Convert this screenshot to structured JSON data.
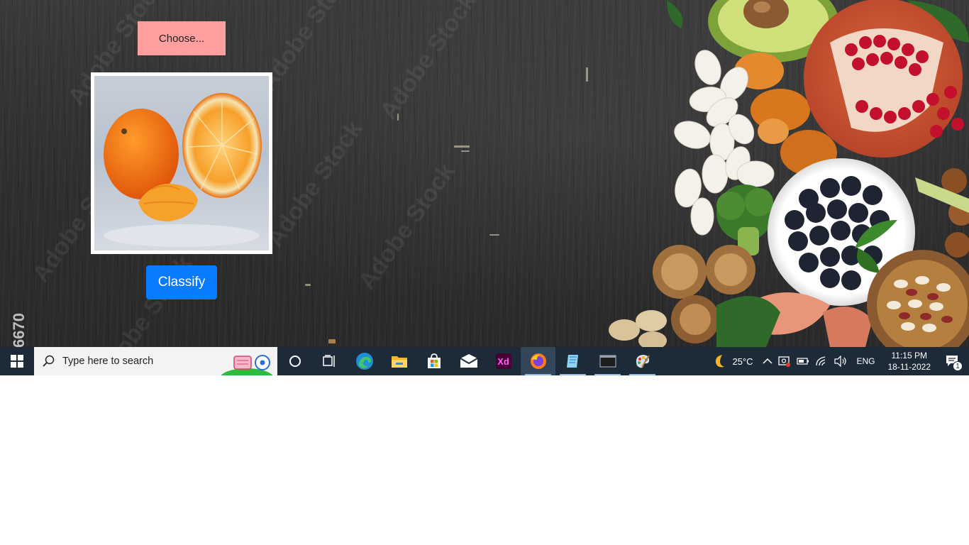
{
  "app": {
    "choose_label": "Choose...",
    "classify_label": "Classify",
    "side_number": "6670",
    "watermark_text": "Adobe Stock",
    "preview_image": "orange-fruit-photo"
  },
  "taskbar": {
    "search_placeholder": "Type here to search",
    "pinned": [
      {
        "name": "cortana",
        "icon": "circle-icon"
      },
      {
        "name": "task-view",
        "icon": "task-view-icon"
      },
      {
        "name": "edge",
        "icon": "edge-icon"
      },
      {
        "name": "file-explorer",
        "icon": "folder-icon"
      },
      {
        "name": "store",
        "icon": "store-icon"
      },
      {
        "name": "mail",
        "icon": "mail-icon"
      },
      {
        "name": "adobe-xd",
        "icon": "xd-icon",
        "label": "Xd"
      },
      {
        "name": "firefox",
        "icon": "firefox-icon"
      },
      {
        "name": "notepad",
        "icon": "notepad-icon"
      },
      {
        "name": "terminal",
        "icon": "terminal-icon"
      },
      {
        "name": "paint",
        "icon": "paint-icon"
      }
    ],
    "weather": {
      "temp": "25°C",
      "icon": "moon-icon"
    },
    "language": "ENG",
    "time": "11:15 PM",
    "date": "18-11-2022",
    "notification_count": "1"
  },
  "colors": {
    "choose_bg": "#ff9f9f",
    "classify_bg": "#0a7bff",
    "taskbar_bg": "#1d2b38"
  }
}
